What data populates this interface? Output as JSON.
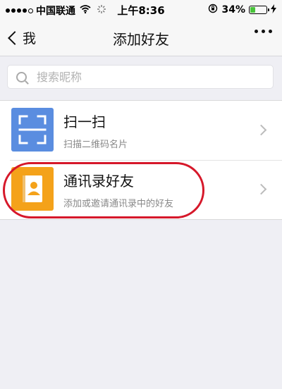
{
  "status_bar": {
    "carrier": "中国联通",
    "time": "上午8:36",
    "battery": "34%",
    "battery_level": 0.34,
    "icons": [
      "signal-dots-icon",
      "wifi-icon",
      "activity-icon",
      "rotation-lock-icon",
      "battery-icon",
      "charging-icon"
    ]
  },
  "nav": {
    "back_label": "我",
    "title": "添加好友",
    "more_icon": "more-dots-icon"
  },
  "search": {
    "placeholder": "搜索昵称",
    "value": ""
  },
  "items": [
    {
      "title": "扫一扫",
      "subtitle": "扫描二维码名片",
      "icon": "scan-icon",
      "color": "#5a8de0"
    },
    {
      "title": "通讯录好友",
      "subtitle": "添加或邀请通讯录中的好友",
      "icon": "contacts-book-icon",
      "color": "#f4a21a"
    }
  ],
  "colors": {
    "highlight": "#d6182a",
    "battery_fill": "#49c33a",
    "background": "#efeff4"
  }
}
